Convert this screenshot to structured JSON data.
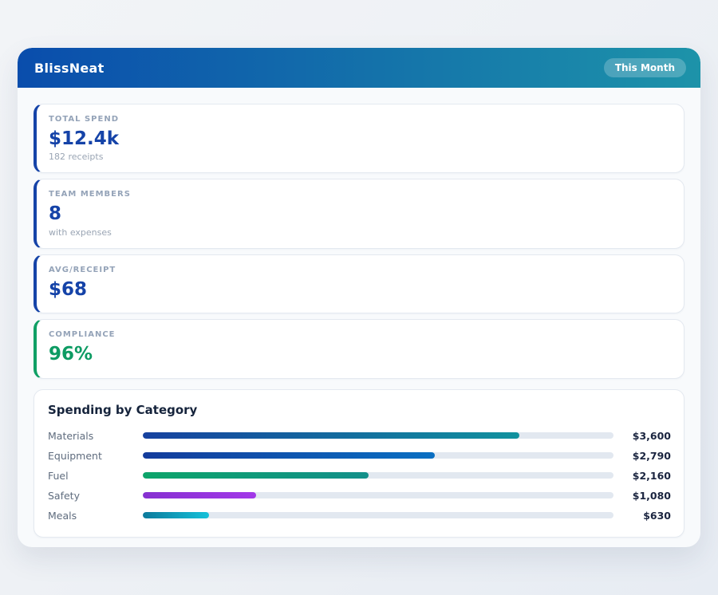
{
  "header": {
    "app_name": "BlissNeat",
    "period_badge": "This Month",
    "gradient_from": "#0a4dac",
    "gradient_to": "#1d93a9"
  },
  "stats": [
    {
      "label": "TOTAL SPEND",
      "value": "$12.4k",
      "sub": "182 receipts",
      "accent": "#1543a8",
      "value_color": "#1543a8"
    },
    {
      "label": "TEAM MEMBERS",
      "value": "8",
      "sub": "with expenses",
      "accent": "#1543a8",
      "value_color": "#1543a8"
    },
    {
      "label": "AVG/RECEIPT",
      "value": "$68",
      "accent": "#1543a8",
      "value_color": "#1543a8"
    },
    {
      "label": "COMPLIANCE",
      "value": "96%",
      "accent": "#10a065",
      "value_color": "#0d9b63"
    }
  ],
  "category_section": {
    "title": "Spending by Category",
    "rows": [
      {
        "label": "Materials",
        "value_label": "$3,600",
        "pct": 80,
        "color_from": "#16419f",
        "color_to": "#11929e"
      },
      {
        "label": "Equipment",
        "value_label": "$2,790",
        "pct": 62,
        "color_from": "#133c9c",
        "color_to": "#0a6fc2"
      },
      {
        "label": "Fuel",
        "value_label": "$2,160",
        "pct": 48,
        "color_from": "#0da46a",
        "color_to": "#128f8a"
      },
      {
        "label": "Safety",
        "value_label": "$1,080",
        "pct": 24,
        "color_from": "#8631d1",
        "color_to": "#a238e8"
      },
      {
        "label": "Meals",
        "value_label": "$630",
        "pct": 14,
        "color_from": "#0d7a9c",
        "color_to": "#15c1d9"
      }
    ]
  },
  "chart_data": {
    "type": "bar",
    "orientation": "horizontal",
    "title": "Spending by Category",
    "categories": [
      "Materials",
      "Equipment",
      "Fuel",
      "Safety",
      "Meals"
    ],
    "values": [
      3600,
      2790,
      2160,
      1080,
      630
    ],
    "value_labels": [
      "$3,600",
      "$2,790",
      "$2,160",
      "$1,080",
      "$630"
    ],
    "xlabel": "",
    "ylabel": "",
    "xlim": [
      0,
      4500
    ],
    "grid": false,
    "legend": false
  }
}
